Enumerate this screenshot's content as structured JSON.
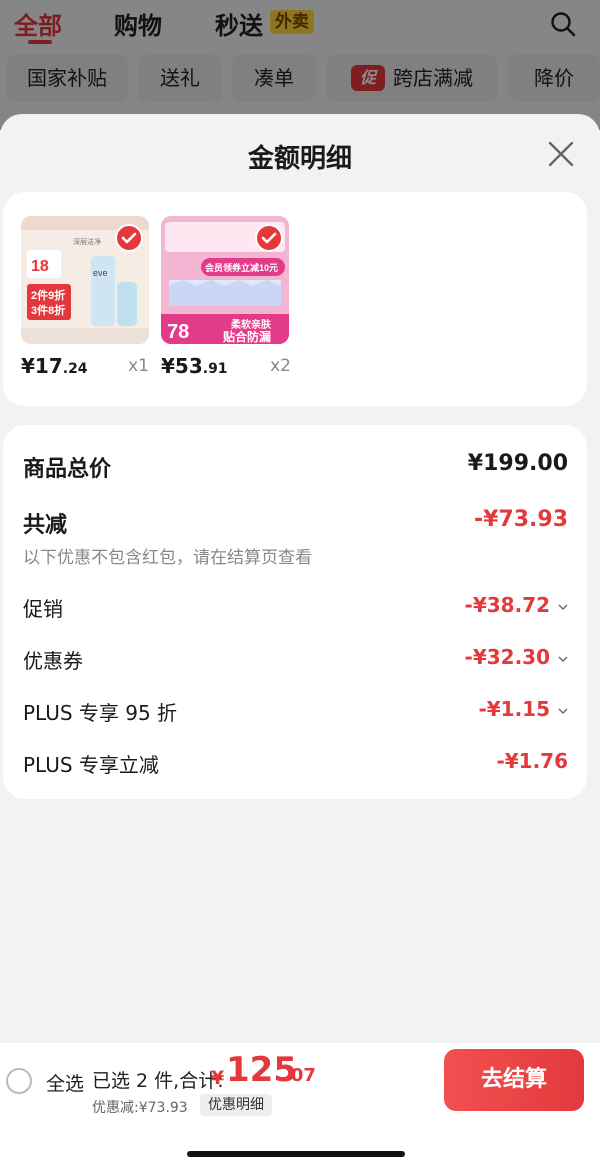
{
  "topbar": {
    "tabs": [
      "全部",
      "购物",
      "秒送"
    ],
    "takeout_badge": "外卖"
  },
  "chips": [
    "国家补贴",
    "送礼",
    "凑单",
    "跨店满减",
    "降价"
  ],
  "promo_mark": "促",
  "sheet": {
    "title": "金额明细"
  },
  "products": [
    {
      "price_int": "¥17",
      "price_dec": ".24",
      "qty": "x1"
    },
    {
      "price_int": "¥53",
      "price_dec": ".91",
      "qty": "x2"
    }
  ],
  "product1_art": {
    "brand": "eve",
    "headline": "深层洁净",
    "price_tag": "18",
    "promo_line1": "2件9折",
    "promo_line2": "3件8折"
  },
  "product2_art": {
    "banner": "会员领券立减10元",
    "price_tag": "78",
    "slogan1": "柔软亲肤",
    "slogan2": "贴合防漏"
  },
  "detail": {
    "total_label": "商品总价",
    "total_value": "¥199.00",
    "discount_label": "共减",
    "discount_value": "-¥73.93",
    "note": "以下优惠不包含红包，请在结算页查看",
    "items": [
      {
        "label": "促销",
        "value": "-¥38.72",
        "expandable": true
      },
      {
        "label": "优惠券",
        "value": "-¥32.30",
        "expandable": true
      },
      {
        "label": "PLUS 专享 95 折",
        "value": "-¥1.15",
        "expandable": true
      },
      {
        "label": "PLUS 专享立减",
        "value": "-¥1.76",
        "expandable": false
      }
    ]
  },
  "bottombar": {
    "select_all": "全选",
    "summary": "已选 2 件,合计:",
    "currency": "¥",
    "total_int": "125",
    "total_dec": ".07",
    "saved": "优惠减:¥73.93",
    "detail_button": "优惠明细",
    "checkout": "去结算"
  },
  "colors": {
    "accent": "#e4393c",
    "badge_yellow": "#ffd83d"
  }
}
